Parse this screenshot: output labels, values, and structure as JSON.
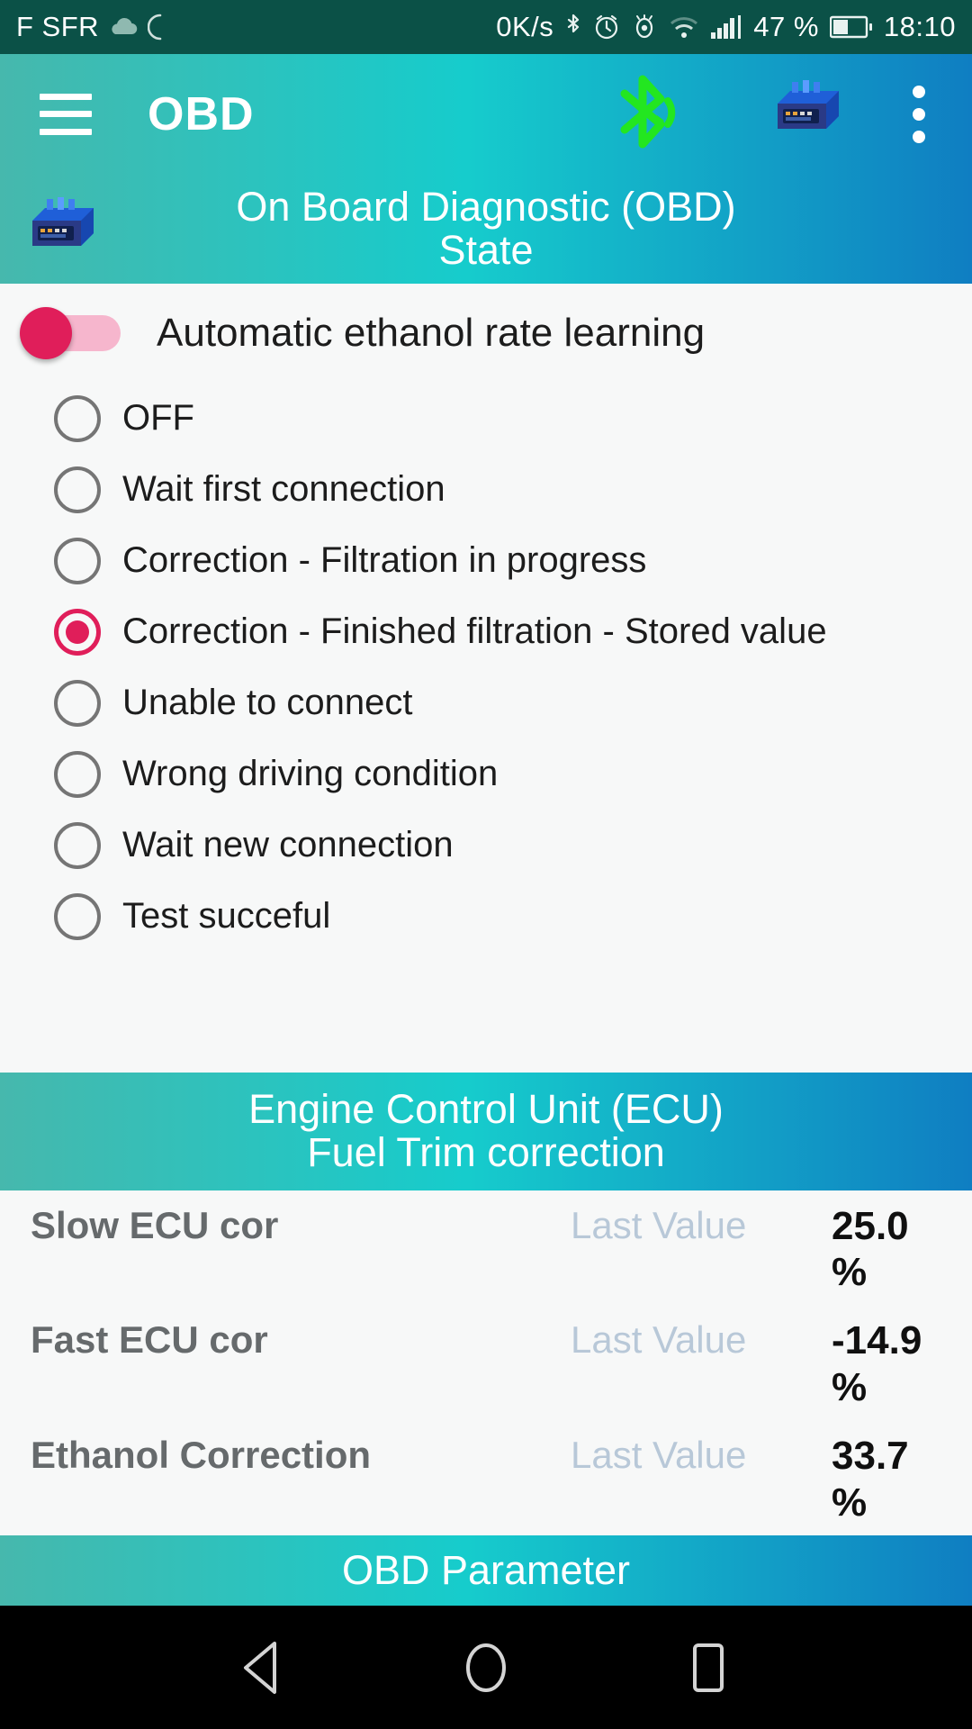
{
  "status_bar": {
    "carrier": "F SFR",
    "cloud_icon": "cloud-icon",
    "sync_icon": "sync-icon",
    "data_rate": "0K/s",
    "bluetooth_icon": "bluetooth-icon",
    "alarm_icon": "alarm-icon",
    "eye_icon": "eye-icon",
    "wifi_icon": "wifi-icon",
    "signal_icon": "signal-bars-icon",
    "battery_percent": "47 %",
    "battery_icon": "battery-icon",
    "clock": "18:10",
    "background_color": "#0b5147"
  },
  "app_bar": {
    "menu_icon": "hamburger-menu-icon",
    "title": "OBD",
    "bluetooth_icon": "bluetooth-connected-icon",
    "dongle_icon": "obd-dongle-icon",
    "overflow_icon": "overflow-menu-icon",
    "gradient_start": "#46b8ad",
    "gradient_mid": "#16cccc",
    "gradient_end": "#0f7ec2"
  },
  "obd_state_section": {
    "icon": "obd-dongle-icon",
    "title_line1": "On Board Diagnostic (OBD)",
    "title_line2": "State"
  },
  "ethanol_learning": {
    "switch_label": "Automatic ethanol rate learning",
    "switch_on": false,
    "accent_color": "#e01e5a",
    "track_color": "#f6b6cd",
    "options": [
      {
        "label": "OFF",
        "selected": false
      },
      {
        "label": "Wait first connection",
        "selected": false
      },
      {
        "label": "Correction - Filtration in progress",
        "selected": false
      },
      {
        "label": "Correction - Finished filtration - Stored value",
        "selected": true
      },
      {
        "label": "Unable to connect",
        "selected": false
      },
      {
        "label": "Wrong driving condition",
        "selected": false
      },
      {
        "label": "Wait new connection",
        "selected": false
      },
      {
        "label": "Test succeful",
        "selected": false
      }
    ]
  },
  "ecu_section": {
    "title_line1": "Engine Control Unit (ECU)",
    "title_line2": "Fuel Trim correction",
    "rows": [
      {
        "name": "Slow ECU cor",
        "label": "Last Value",
        "value": "25.0 %"
      },
      {
        "name": "Fast ECU cor",
        "label": "Last Value",
        "value": "-14.9 %"
      },
      {
        "name": "Ethanol Correction",
        "label": "Last Value",
        "value": "33.7 %"
      }
    ]
  },
  "obd_parameter_section": {
    "title": "OBD Parameter"
  },
  "nav_bar": {
    "back_icon": "back-triangle-icon",
    "home_icon": "home-circle-icon",
    "recents_icon": "recents-square-icon"
  }
}
